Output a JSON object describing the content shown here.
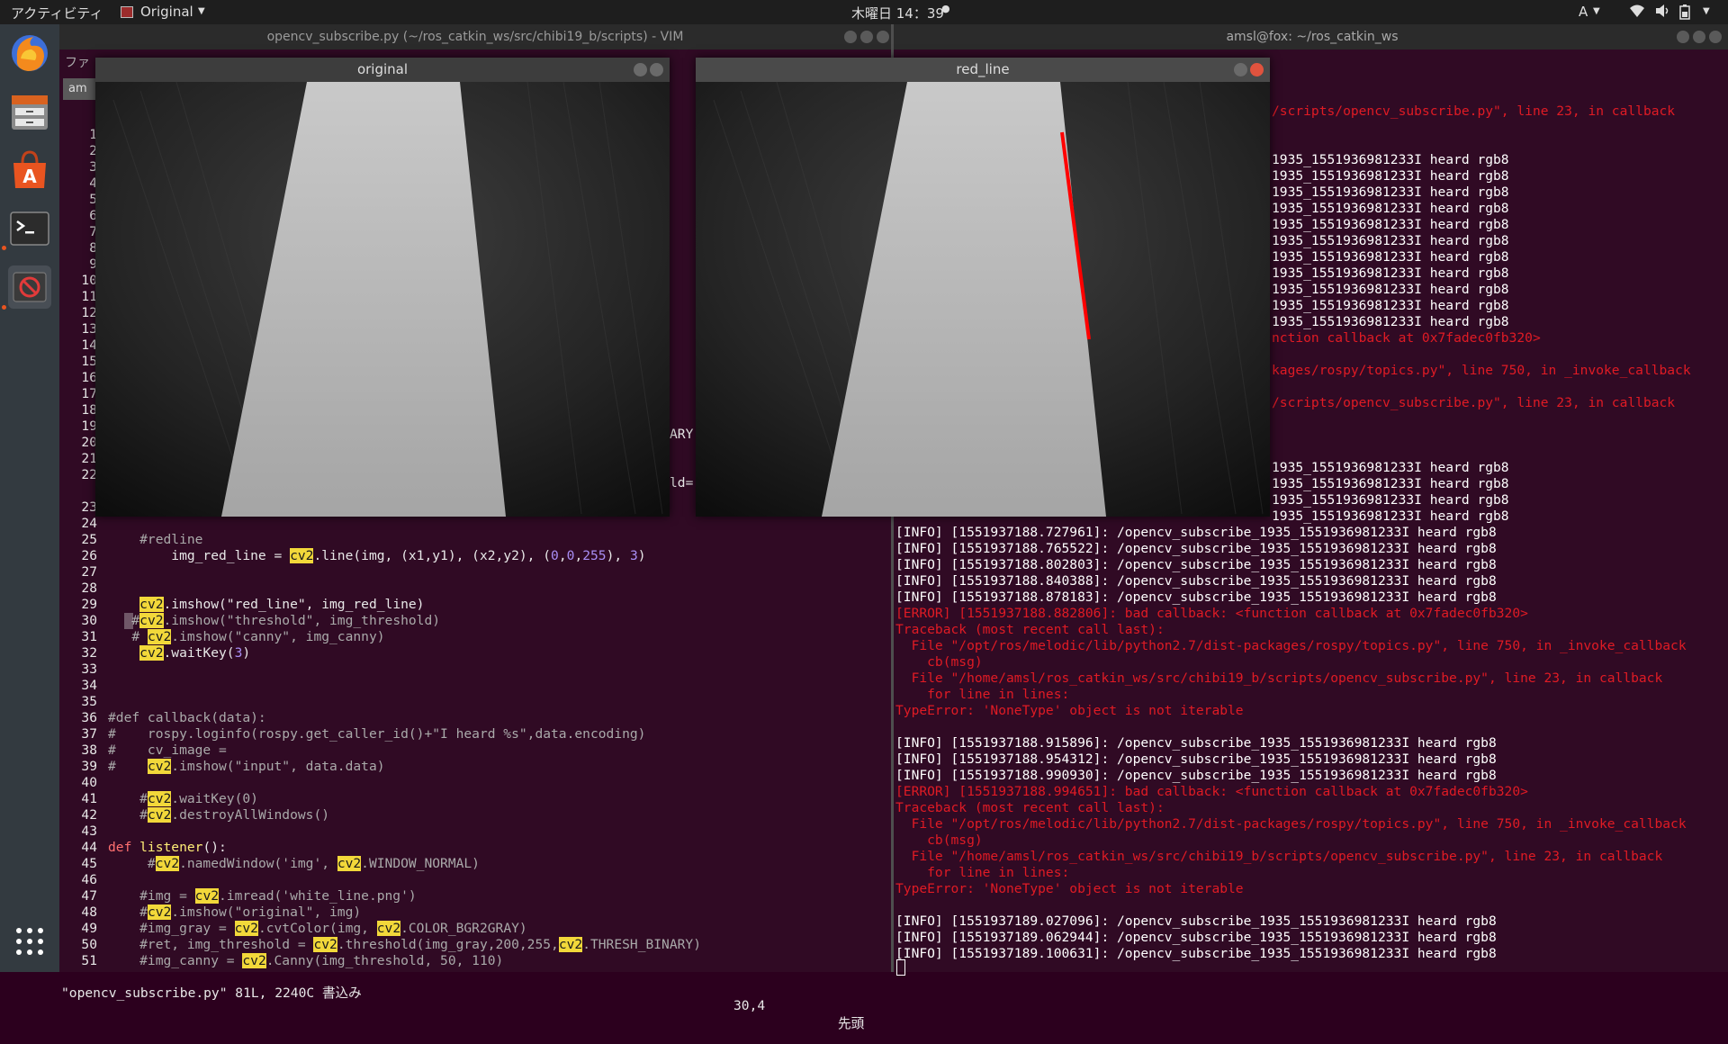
{
  "topbar": {
    "activities": "アクティビティ",
    "app_menu": "Original",
    "clock": "木曜日 14：39",
    "input_method": "A"
  },
  "dock": {
    "items": [
      "firefox-icon",
      "files-icon",
      "software-center-icon",
      "terminal-icon",
      "no-entry-icon"
    ]
  },
  "vim_window": {
    "title": "opencv_subscribe.py (~/ros_catkin_ws/src/chibi19_b/scripts) - VIM",
    "menu_fragment": "ファ",
    "tab_label": "am",
    "partial_text_19": "ARY",
    "partial_text_22": "ld=",
    "line_numbers": [
      "1",
      "2",
      "3",
      "4",
      "5",
      "6",
      "7",
      "8",
      "9",
      "10",
      "11",
      "12",
      "13",
      "14",
      "15",
      "16",
      "17",
      "18",
      "19",
      "20",
      "21",
      "22",
      "23",
      "24",
      "25",
      "26",
      "27",
      "28",
      "29",
      "30",
      "31",
      "32",
      "33",
      "34",
      "35",
      "36",
      "37",
      "38",
      "39",
      "40",
      "41",
      "42",
      "43",
      "44",
      "45",
      "46",
      "47",
      "48",
      "49",
      "50",
      "51"
    ],
    "code_25": "    #redline",
    "code_26_a": "        img_red_line = ",
    "code_26_b": "cv2",
    "code_26_c": ".line(img, (x1,y1), (x2,y2), (",
    "code_26_d": "0",
    "code_26_e": ",",
    "code_26_f": "0",
    "code_26_g": ",",
    "code_26_h": "255",
    "code_26_i": "), ",
    "code_26_j": "3",
    "code_26_k": ")",
    "code_29_a": "    ",
    "code_29_b": "cv2",
    "code_29_c": ".imshow(\"red_line\", img_red_line)",
    "code_30_a": "   #",
    "code_30_b": "cv2",
    "code_30_c": ".imshow(\"threshold\", img_threshold)",
    "code_31_a": "   # ",
    "code_31_b": "cv2",
    "code_31_c": ".imshow(\"canny\", img_canny)",
    "code_32_a": "    ",
    "code_32_b": "cv2",
    "code_32_c": ".waitKey(",
    "code_32_d": "3",
    "code_32_e": ")",
    "code_36": "#def callback(data):",
    "code_37": "#    rospy.loginfo(rospy.get_caller_id()+\"I heard %s\",data.encoding)",
    "code_38": "#    cv_image = ",
    "code_39_a": "#    ",
    "code_39_b": "cv2",
    "code_39_c": ".imshow(\"input\", data.data)",
    "code_41_a": "    #",
    "code_41_b": "cv2",
    "code_41_c": ".waitKey(0)",
    "code_42_a": "    #",
    "code_42_b": "cv2",
    "code_42_c": ".destroyAllWindows()",
    "code_44_a": "def",
    "code_44_b": " listener",
    "code_44_c": "():",
    "code_45_a": "     #",
    "code_45_b": "cv2",
    "code_45_c": ".namedWindow('img', ",
    "code_45_d": "cv2",
    "code_45_e": ".WINDOW_NORMAL)",
    "code_47_a": "    #img = ",
    "code_47_b": "cv2",
    "code_47_c": ".imread('white_line.png')",
    "code_48_a": "    #",
    "code_48_b": "cv2",
    "code_48_c": ".imshow(\"original\", img)",
    "code_49_a": "    #img_gray = ",
    "code_49_b": "cv2",
    "code_49_c": ".cvtColor(img, ",
    "code_49_d": "cv2",
    "code_49_e": ".COLOR_BGR2GRAY)",
    "code_50_a": "    #ret, img_threshold = ",
    "code_50_b": "cv2",
    "code_50_c": ".threshold(img_gray,200,255,",
    "code_50_d": "cv2",
    "code_50_e": ".THRESH_BINARY)",
    "code_51_a": "    #img_canny = ",
    "code_51_b": "cv2",
    "code_51_c": ".Canny(img_threshold, 50, 110)",
    "status_file": "\"opencv_subscribe.py\" 81L, 2240C 書込み",
    "status_pos": "30,4",
    "status_scroll": "先頭"
  },
  "terminal_window": {
    "title": "amsl@fox: ~/ros_catkin_ws",
    "lines": [
      {
        "kind": "err",
        "text": "/scripts/opencv_subscribe.py\", line 23, in callback"
      },
      {
        "kind": "info",
        "text": ""
      },
      {
        "kind": "info",
        "text": ""
      },
      {
        "kind": "info",
        "text": "1935_1551936981233I heard rgb8"
      },
      {
        "kind": "info",
        "text": "1935_1551936981233I heard rgb8"
      },
      {
        "kind": "info",
        "text": "1935_1551936981233I heard rgb8"
      },
      {
        "kind": "info",
        "text": "1935_1551936981233I heard rgb8"
      },
      {
        "kind": "info",
        "text": "1935_1551936981233I heard rgb8"
      },
      {
        "kind": "info",
        "text": "1935_1551936981233I heard rgb8"
      },
      {
        "kind": "info",
        "text": "1935_1551936981233I heard rgb8"
      },
      {
        "kind": "info",
        "text": "1935_1551936981233I heard rgb8"
      },
      {
        "kind": "info",
        "text": "1935_1551936981233I heard rgb8"
      },
      {
        "kind": "info",
        "text": "1935_1551936981233I heard rgb8"
      },
      {
        "kind": "info",
        "text": "1935_1551936981233I heard rgb8"
      },
      {
        "kind": "err",
        "text": "nction callback at 0x7fadec0fb320>"
      },
      {
        "kind": "info",
        "text": ""
      },
      {
        "kind": "err",
        "text": "kages/rospy/topics.py\", line 750, in _invoke_callback"
      },
      {
        "kind": "info",
        "text": ""
      },
      {
        "kind": "err",
        "text": "/scripts/opencv_subscribe.py\", line 23, in callback"
      },
      {
        "kind": "info",
        "text": ""
      },
      {
        "kind": "info",
        "text": ""
      },
      {
        "kind": "info",
        "text": ""
      },
      {
        "kind": "info",
        "text": "1935_1551936981233I heard rgb8"
      },
      {
        "kind": "info",
        "text": "1935_1551936981233I heard rgb8"
      },
      {
        "kind": "info",
        "text": "1935_1551936981233I heard rgb8"
      },
      {
        "kind": "info",
        "text": "1935_1551936981233I heard rgb8"
      },
      {
        "kind": "info",
        "text": "[INFO] [1551937188.727961]: /opencv_subscribe_1935_1551936981233I heard rgb8"
      },
      {
        "kind": "info",
        "text": "[INFO] [1551937188.765522]: /opencv_subscribe_1935_1551936981233I heard rgb8"
      },
      {
        "kind": "info",
        "text": "[INFO] [1551937188.802803]: /opencv_subscribe_1935_1551936981233I heard rgb8"
      },
      {
        "kind": "info",
        "text": "[INFO] [1551937188.840388]: /opencv_subscribe_1935_1551936981233I heard rgb8"
      },
      {
        "kind": "info",
        "text": "[INFO] [1551937188.878183]: /opencv_subscribe_1935_1551936981233I heard rgb8"
      },
      {
        "kind": "err",
        "text": "[ERROR] [1551937188.882806]: bad callback: <function callback at 0x7fadec0fb320>"
      },
      {
        "kind": "err",
        "text": "Traceback (most recent call last):"
      },
      {
        "kind": "err",
        "text": "  File \"/opt/ros/melodic/lib/python2.7/dist-packages/rospy/topics.py\", line 750, in _invoke_callback"
      },
      {
        "kind": "err",
        "text": "    cb(msg)"
      },
      {
        "kind": "err",
        "text": "  File \"/home/amsl/ros_catkin_ws/src/chibi19_b/scripts/opencv_subscribe.py\", line 23, in callback"
      },
      {
        "kind": "err",
        "text": "    for line in lines:"
      },
      {
        "kind": "err",
        "text": "TypeError: 'NoneType' object is not iterable"
      },
      {
        "kind": "info",
        "text": ""
      },
      {
        "kind": "info",
        "text": "[INFO] [1551937188.915896]: /opencv_subscribe_1935_1551936981233I heard rgb8"
      },
      {
        "kind": "info",
        "text": "[INFO] [1551937188.954312]: /opencv_subscribe_1935_1551936981233I heard rgb8"
      },
      {
        "kind": "info",
        "text": "[INFO] [1551937188.990930]: /opencv_subscribe_1935_1551936981233I heard rgb8"
      },
      {
        "kind": "err",
        "text": "[ERROR] [1551937188.994651]: bad callback: <function callback at 0x7fadec0fb320>"
      },
      {
        "kind": "err",
        "text": "Traceback (most recent call last):"
      },
      {
        "kind": "err",
        "text": "  File \"/opt/ros/melodic/lib/python2.7/dist-packages/rospy/topics.py\", line 750, in _invoke_callback"
      },
      {
        "kind": "err",
        "text": "    cb(msg)"
      },
      {
        "kind": "err",
        "text": "  File \"/home/amsl/ros_catkin_ws/src/chibi19_b/scripts/opencv_subscribe.py\", line 23, in callback"
      },
      {
        "kind": "err",
        "text": "    for line in lines:"
      },
      {
        "kind": "err",
        "text": "TypeError: 'NoneType' object is not iterable"
      },
      {
        "kind": "info",
        "text": ""
      },
      {
        "kind": "info",
        "text": "[INFO] [1551937189.027096]: /opencv_subscribe_1935_1551936981233I heard rgb8"
      },
      {
        "kind": "info",
        "text": "[INFO] [1551937189.062944]: /opencv_subscribe_1935_1551936981233I heard rgb8"
      },
      {
        "kind": "info",
        "text": "[INFO] [1551937189.100631]: /opencv_subscribe_1935_1551936981233I heard rgb8"
      }
    ]
  },
  "original_window": {
    "title": "original"
  },
  "red_line_window": {
    "title": "red_line"
  },
  "colors": {
    "terminal_bg": "#300a24",
    "error_red": "#e01b24",
    "highlight": "#f2d83a",
    "red_line": "#ff0000"
  }
}
